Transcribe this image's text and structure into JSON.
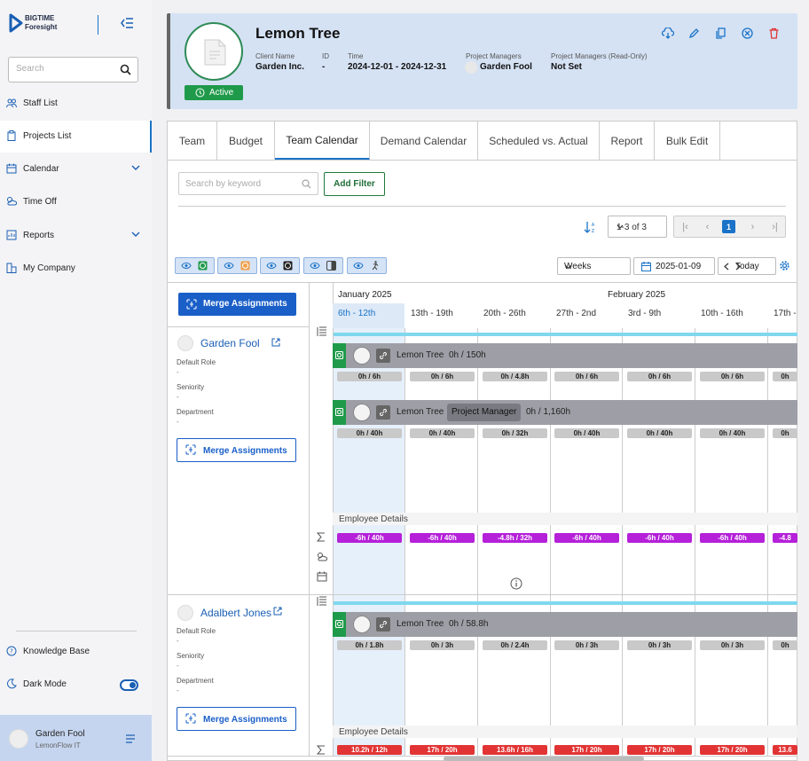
{
  "sidebar": {
    "logo_line1": "BIGTIME",
    "logo_line2": "Foresight",
    "search_placeholder": "Search",
    "items": [
      {
        "label": "Staff List",
        "icon": "people-icon"
      },
      {
        "label": "Projects List",
        "icon": "clipboard-icon",
        "active": true
      },
      {
        "label": "Calendar",
        "icon": "calendar-icon",
        "expandable": true
      },
      {
        "label": "Time Off",
        "icon": "cloud-sun-icon"
      },
      {
        "label": "Reports",
        "icon": "report-icon",
        "expandable": true
      },
      {
        "label": "My Company",
        "icon": "building-icon"
      }
    ],
    "knowledge_base": "Knowledge Base",
    "dark_mode": "Dark Mode",
    "user": {
      "name": "Garden Fool",
      "org": "LemonFlow IT"
    }
  },
  "header": {
    "title": "Lemon Tree",
    "status": "Active",
    "client_label": "Client Name",
    "client_value": "Garden Inc.",
    "id_label": "ID",
    "id_value": "-",
    "time_label": "Time",
    "time_value": "2024-12-01 - 2024-12-31",
    "pm_label": "Project Managers",
    "pm_value": "Garden Fool",
    "pm_ro_label": "Project Managers (Read-Only)",
    "pm_ro_value": "Not Set"
  },
  "tabs": [
    "Team",
    "Budget",
    "Team Calendar",
    "Demand Calendar",
    "Scheduled vs. Actual",
    "Report",
    "Bulk Edit"
  ],
  "active_tab": "Team Calendar",
  "toolbar": {
    "keyword_placeholder": "Search by keyword",
    "add_filter": "Add Filter",
    "page_info": "1-3 of 3",
    "current_page": "1",
    "view_mode": "Weeks",
    "date": "2025-01-09",
    "today": "Today"
  },
  "calendar": {
    "months": [
      "January 2025",
      "February 2025"
    ],
    "weeks": [
      "6th - 12th",
      "13th - 19th",
      "20th - 26th",
      "27th - 2nd",
      "3rd - 9th",
      "10th - 16th",
      "17th - "
    ],
    "merge_label": "Merge Assignments",
    "employee_details": "Employee Details",
    "staff": [
      {
        "name": "Garden Fool",
        "default_role_label": "Default Role",
        "default_role": "-",
        "seniority_label": "Seniority",
        "seniority": "-",
        "department_label": "Department",
        "department": "-",
        "assignments": [
          {
            "project": "Lemon Tree",
            "hours": "0h / 150h",
            "role": "",
            "cells": [
              "0h / 6h",
              "0h / 6h",
              "0h / 4.8h",
              "0h / 6h",
              "0h / 6h",
              "0h / 6h",
              "0h"
            ]
          },
          {
            "project": "Lemon Tree",
            "hours": "0h / 1,160h",
            "role": "Project Manager",
            "cells": [
              "0h / 40h",
              "0h / 40h",
              "0h / 32h",
              "0h / 40h",
              "0h / 40h",
              "0h / 40h",
              "0h"
            ]
          }
        ],
        "totals": [
          "-6h / 40h",
          "-6h / 40h",
          "-4.8h / 32h",
          "-6h / 40h",
          "-6h / 40h",
          "-6h / 40h",
          "-4.8"
        ],
        "totals_color": "#b520d9"
      },
      {
        "name": "Adalbert Jones",
        "default_role_label": "Default Role",
        "default_role": "-",
        "seniority_label": "Seniority",
        "seniority": "-",
        "department_label": "Department",
        "department": "-",
        "assignments": [
          {
            "project": "Lemon Tree",
            "hours": "0h / 58.8h",
            "role": "",
            "cells": [
              "0h / 1.8h",
              "0h / 3h",
              "0h / 2.4h",
              "0h / 3h",
              "0h / 3h",
              "0h / 3h",
              "0h"
            ]
          }
        ],
        "totals": [
          "10.2h / 12h",
          "17h / 20h",
          "13.6h / 16h",
          "17h / 20h",
          "17h / 20h",
          "17h / 20h",
          "13.6"
        ],
        "totals_color": "#e23434"
      }
    ]
  },
  "colors": {
    "accent": "#1a73c8",
    "active_green": "#1f9a4a",
    "header_bg": "#d5e2f4",
    "cyan_bar": "#7fd8ee"
  }
}
